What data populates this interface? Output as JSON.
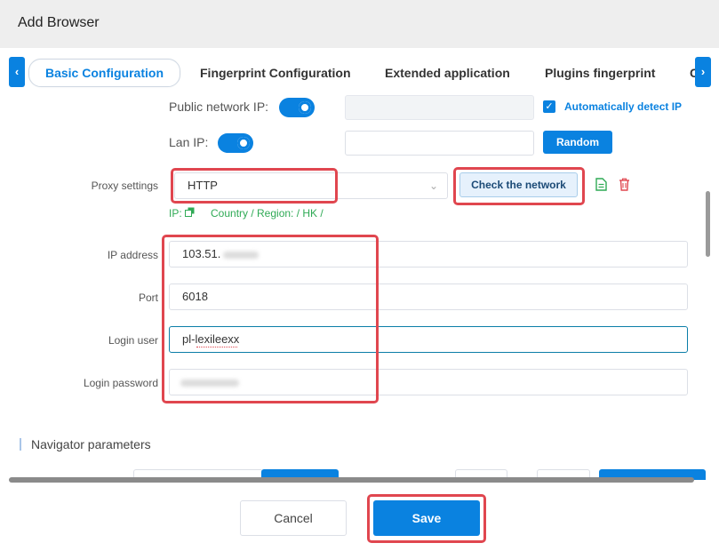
{
  "dialog": {
    "title": "Add Browser"
  },
  "tabs": [
    {
      "label": "Basic Configuration",
      "active": true
    },
    {
      "label": "Fingerprint Configuration"
    },
    {
      "label": "Extended application"
    },
    {
      "label": "Plugins fingerprint"
    },
    {
      "label": "C"
    }
  ],
  "network": {
    "public_ip_label": "Public network IP:",
    "lan_ip_label": "Lan IP:",
    "auto_detect_label": "Automatically detect IP",
    "random_button": "Random"
  },
  "proxy": {
    "settings_label": "Proxy settings",
    "type_value": "HTTP",
    "check_button": "Check the network",
    "ip_label": "IP:",
    "region_text": "Country / Region: / HK /",
    "ip_address_label": "IP address",
    "ip_address_value": "103.51.",
    "port_label": "Port",
    "port_value": "6018",
    "login_user_label": "Login user",
    "login_user_value": "pl-lexileexx",
    "login_password_label": "Login password"
  },
  "section": {
    "navigator_title": "Navigator parameters"
  },
  "footer": {
    "cancel_label": "Cancel",
    "save_label": "Save"
  },
  "colors": {
    "accent": "#0a82e0",
    "highlight": "#e0464f",
    "success": "#2faa55"
  }
}
